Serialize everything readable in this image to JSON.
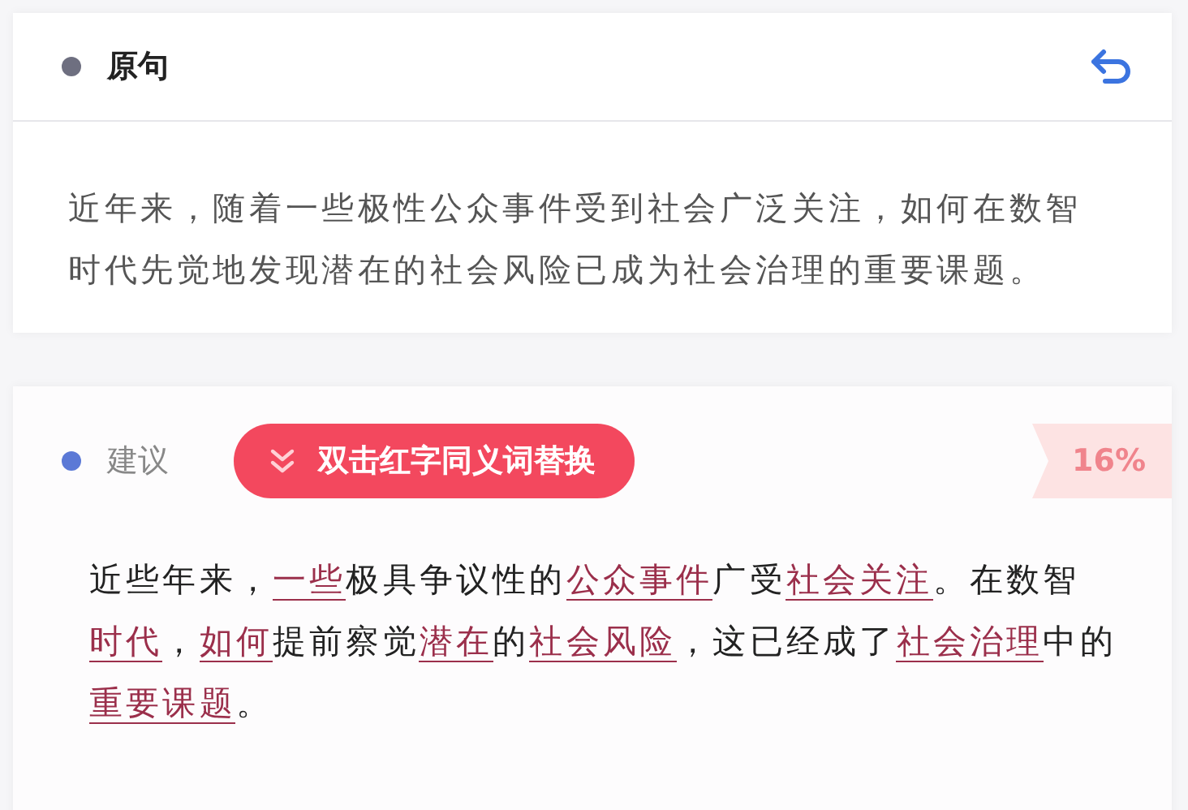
{
  "original": {
    "title": "原句",
    "text": "近年来，随着一些极性公众事件受到社会广泛关注，如何在数智时代先觉地发现潜在的社会风险已成为社会治理的重要课题。"
  },
  "suggestion": {
    "title": "建议",
    "hint_button": "双击红字同义词替换",
    "score": "16%",
    "segments": [
      {
        "text": "近些年来，",
        "kind": "plain"
      },
      {
        "text": "一些",
        "kind": "synonym"
      },
      {
        "text": "极具争议性的",
        "kind": "plain"
      },
      {
        "text": "公众事件",
        "kind": "synonym"
      },
      {
        "text": "广受",
        "kind": "plain"
      },
      {
        "text": "社会关注",
        "kind": "synonym"
      },
      {
        "text": "。在数智",
        "kind": "plain"
      },
      {
        "text": "时代",
        "kind": "synonym"
      },
      {
        "text": "，",
        "kind": "plain"
      },
      {
        "text": "如何",
        "kind": "synonym"
      },
      {
        "text": "提前察觉",
        "kind": "plain"
      },
      {
        "text": "潜在",
        "kind": "synonym"
      },
      {
        "text": "的",
        "kind": "plain"
      },
      {
        "text": "社会风险",
        "kind": "synonym"
      },
      {
        "text": "，这已经成了",
        "kind": "plain"
      },
      {
        "text": "社会治理",
        "kind": "synonym"
      },
      {
        "text": "中的",
        "kind": "plain"
      },
      {
        "text": "重要课题",
        "kind": "synonym"
      },
      {
        "text": "。",
        "kind": "plain"
      }
    ]
  }
}
